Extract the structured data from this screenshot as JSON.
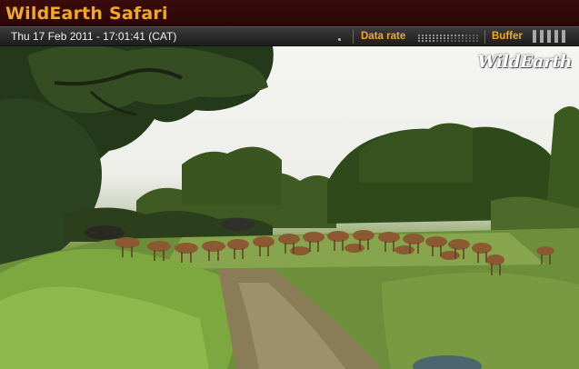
{
  "app": {
    "title": "WildEarth Safari"
  },
  "status": {
    "datetime": "Thu 17 Feb 2011 - 17:01:41 (CAT)",
    "data_rate_label": "Data rate",
    "buffer_label": "Buffer"
  },
  "video": {
    "watermark": "WildEarth",
    "scene": "live-safari-camera-feed-impala-herd"
  },
  "colors": {
    "title": "#f2a91e",
    "title_bar": "#3a0c0c",
    "status_bar": "#2d2d2d",
    "status_accent": "#f2a91e"
  }
}
